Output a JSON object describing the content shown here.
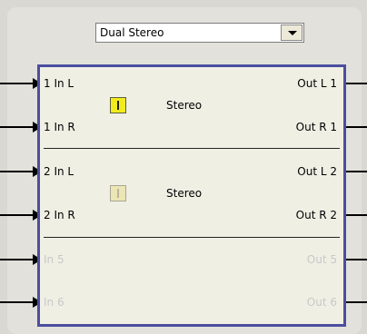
{
  "mode_select": {
    "value": "Dual Stereo"
  },
  "inputs": [
    "1 In L",
    "1 In R",
    "2 In L",
    "2 In R",
    "In 5",
    "In 6"
  ],
  "outputs": [
    "Out L 1",
    "Out R 1",
    "Out L 2",
    "Out R 2",
    "Out 5",
    "Out 6"
  ],
  "channels": [
    {
      "mode_label": "Stereo",
      "button_state": "on"
    },
    {
      "mode_label": "Stereo",
      "button_state": "off"
    }
  ],
  "colors": {
    "frame": "#4b4f9e",
    "button_on": "#f2ec1c",
    "panel": "#f0efe4"
  }
}
